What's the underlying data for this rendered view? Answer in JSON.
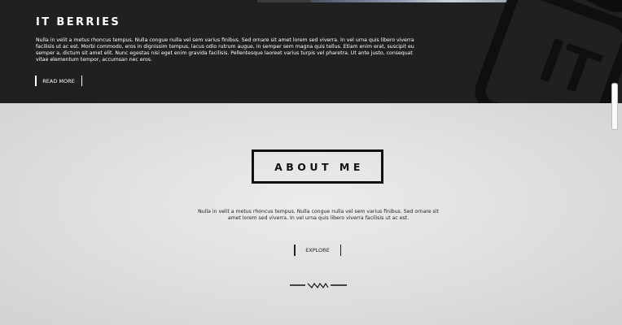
{
  "hero": {
    "title": "IT BERRIES",
    "description": "Nulla in velit a metus rhoncus tempus. Nulla congue nulla vel sem varius finibus. Sed ornare sit amet lorem sed viverra. In vel urna quis libero viverra facilisis ut ac est. Morbi commodo, eros in dignissim tempus, lacus odio rutrum augue, in semper sem magna quis tellus. Etiam enim erat, suscipit eu semper a, dictum sit amet elit. Nunc egestas nisi eget enim gravida facilisis. Pellentesque laoreet varius turpis vel pharetra. Ut ante justo, consequat vitae elementum tempor, accumsan nec eros.",
    "button_label": "READ MORE",
    "logo_text": "IT",
    "logo_icon": "it-logo-icon"
  },
  "about": {
    "title": "ABOUT ME",
    "description": "Nulla in velit a metus rhoncus tempus. Nulla congue nulla vel sem varius finibus. Sed ornare sit amet lorem sed viverra. In vel urna quis libero viverra facilisis ut ac est.",
    "button_label": "EXPLORE",
    "divider_icon": "ornament-divider-icon"
  },
  "colors": {
    "hero_bg": "#202020",
    "page_bg": "#dcdcdc",
    "text_dark": "#111111",
    "text_light": "#ffffff"
  }
}
